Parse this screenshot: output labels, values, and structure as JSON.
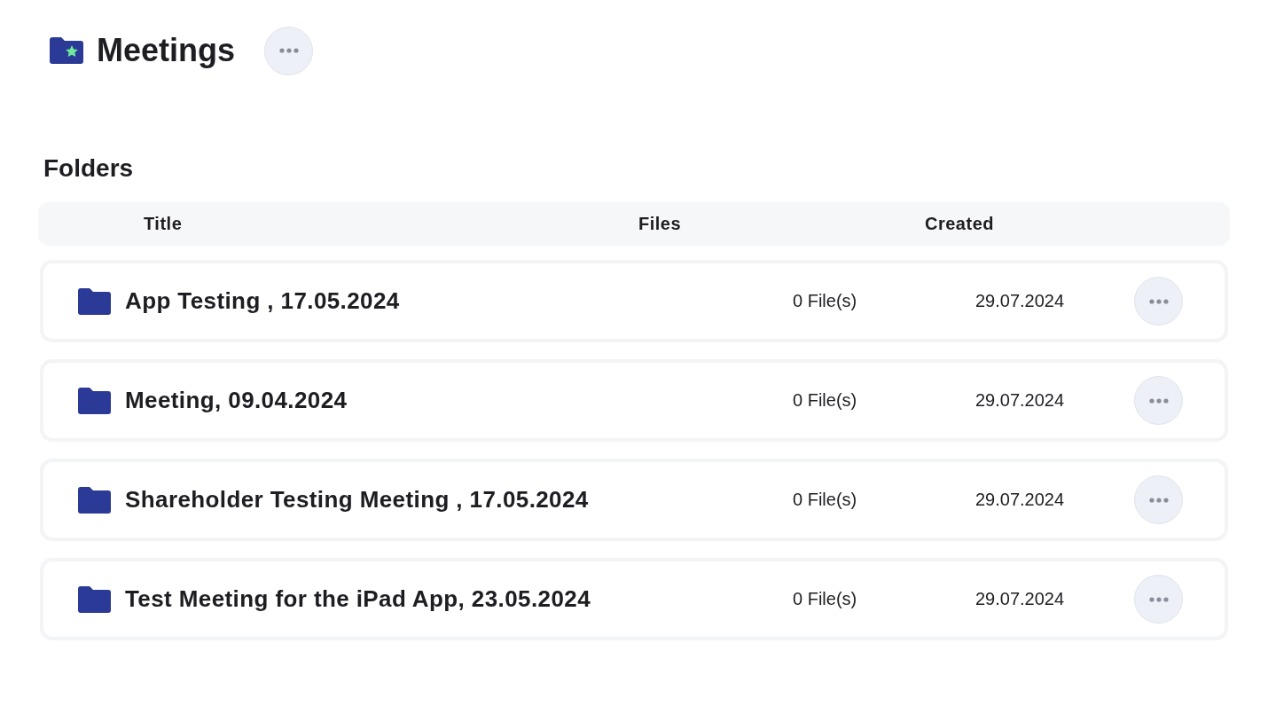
{
  "header": {
    "title": "Meetings"
  },
  "section": {
    "title": "Folders"
  },
  "table": {
    "columns": [
      "Title",
      "Files",
      "Created"
    ],
    "rows": [
      {
        "title": "App Testing , 17.05.2024",
        "files": "0 File(s)",
        "created": "29.07.2024"
      },
      {
        "title": "Meeting, 09.04.2024",
        "files": "0 File(s)",
        "created": "29.07.2024"
      },
      {
        "title": "Shareholder Testing Meeting , 17.05.2024",
        "files": "0 File(s)",
        "created": "29.07.2024"
      },
      {
        "title": "Test Meeting for the iPad App, 23.05.2024",
        "files": "0 File(s)",
        "created": "29.07.2024"
      }
    ]
  }
}
